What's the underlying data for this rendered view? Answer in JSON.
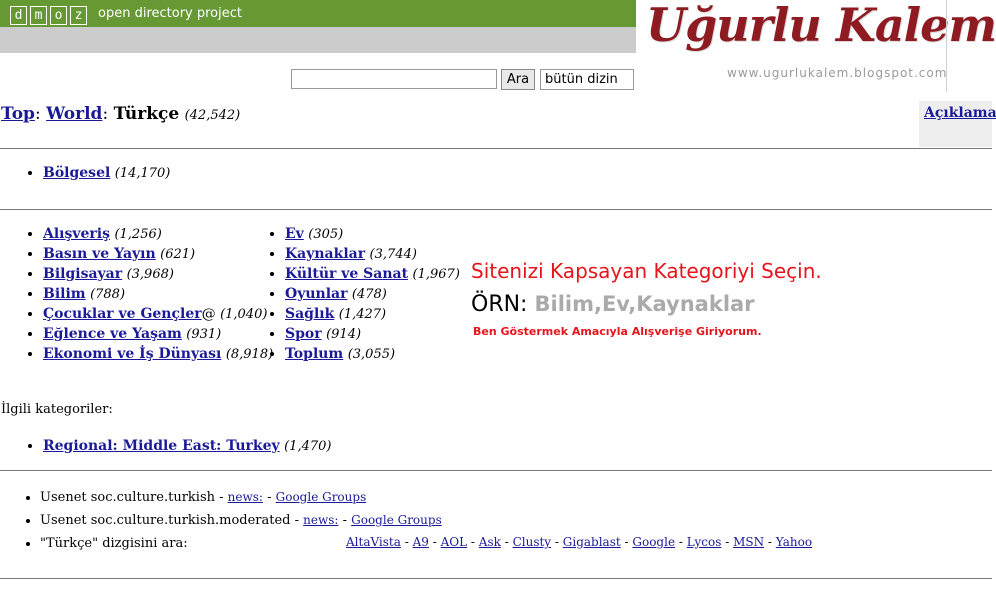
{
  "header": {
    "logo_letters": [
      "d",
      "m",
      "o",
      "z"
    ],
    "tagline": "open directory project",
    "accent": "#669933"
  },
  "watermark": {
    "title": "Uğurlu Kalem",
    "url": "www.ugurlukalem.blogspot.com"
  },
  "search": {
    "value": "",
    "button": "Ara",
    "scope": "bütün dizin"
  },
  "breadcrumb": {
    "top": "Top",
    "world": "World",
    "current": "Türkçe",
    "count": "(42,542)",
    "description_link": "Açıklama"
  },
  "regional": [
    {
      "label": "Bölgesel",
      "count": "(14,170)"
    }
  ],
  "categories_left": [
    {
      "label": "Alışveriş",
      "count": "(1,256)"
    },
    {
      "label": "Basın ve Yayın",
      "count": "(621)"
    },
    {
      "label": "Bilgisayar",
      "count": "(3,968)"
    },
    {
      "label": "Bilim",
      "count": "(788)"
    },
    {
      "label": "Çocuklar ve Gençler",
      "suffix": "@",
      "count": "(1,040)"
    },
    {
      "label": "Eğlence ve Yaşam",
      "count": "(931)"
    },
    {
      "label": "Ekonomi ve İş Dünyası",
      "count": "(8,918)"
    }
  ],
  "categories_right": [
    {
      "label": "Ev",
      "count": "(305)"
    },
    {
      "label": "Kaynaklar",
      "count": "(3,744)"
    },
    {
      "label": "Kültür ve Sanat",
      "count": "(1,967)"
    },
    {
      "label": "Oyunlar",
      "count": "(478)"
    },
    {
      "label": "Sağlık",
      "count": "(1,427)"
    },
    {
      "label": "Spor",
      "count": "(914)"
    },
    {
      "label": "Toplum",
      "count": "(3,055)"
    }
  ],
  "annotation": {
    "title": "Sitenizi Kapsayan Kategoriyi Seçin.",
    "example_label": "ÖRN:",
    "example_values": "Bilim,Ev,Kaynaklar",
    "note": "Ben Göstermek Amacıyla Alışverişe Giriyorum."
  },
  "related": {
    "label": "İlgili kategoriler:",
    "items": [
      {
        "label": "Regional: Middle East: Turkey",
        "count": "(1,470)"
      }
    ]
  },
  "usenet": [
    {
      "text": "Usenet soc.culture.turkish - ",
      "news": "news:",
      "sep": " - ",
      "groups": "Google Groups"
    },
    {
      "text": "Usenet soc.culture.turkish.moderated - ",
      "news": "news:",
      "sep": " - ",
      "groups": "Google Groups"
    }
  ],
  "search_elsewhere": {
    "label": "\"Türkçe\" dizgisini ara:",
    "engines": [
      "AltaVista",
      "A9",
      "AOL",
      "Ask",
      "Clusty",
      "Gigablast",
      "Google",
      "Lycos",
      "MSN",
      "Yahoo"
    ]
  }
}
